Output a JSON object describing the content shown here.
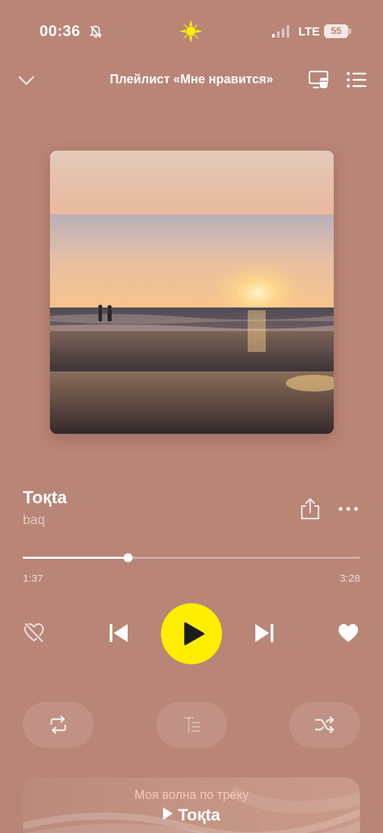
{
  "status_bar": {
    "time": "00:36",
    "network": "LTE",
    "battery": "55",
    "icons": [
      "bell-muted-icon",
      "sun-icon",
      "signal-icon",
      "battery-icon"
    ]
  },
  "header": {
    "title": "Плейлист «Мне нравится»",
    "icons": [
      "chevron-down-icon",
      "cast-device-icon",
      "queue-list-icon"
    ]
  },
  "track": {
    "title": "Toқta",
    "artist": "baq",
    "current_time": "1:37",
    "total_time": "3:28",
    "progress": 0.31
  },
  "controls": {
    "icons": [
      "dislike-icon",
      "previous-icon",
      "play-icon",
      "next-icon",
      "like-heart-icon",
      "share-icon",
      "more-icon"
    ],
    "accent_color": "#ffee00"
  },
  "pills": {
    "icons": [
      "repeat-icon",
      "lyrics-icon",
      "shuffle-icon"
    ]
  },
  "my_wave": {
    "label": "Моя волна по треку",
    "track": "Toқta"
  },
  "colors": {
    "background": "#b98577",
    "play_button": "#ffee00"
  }
}
